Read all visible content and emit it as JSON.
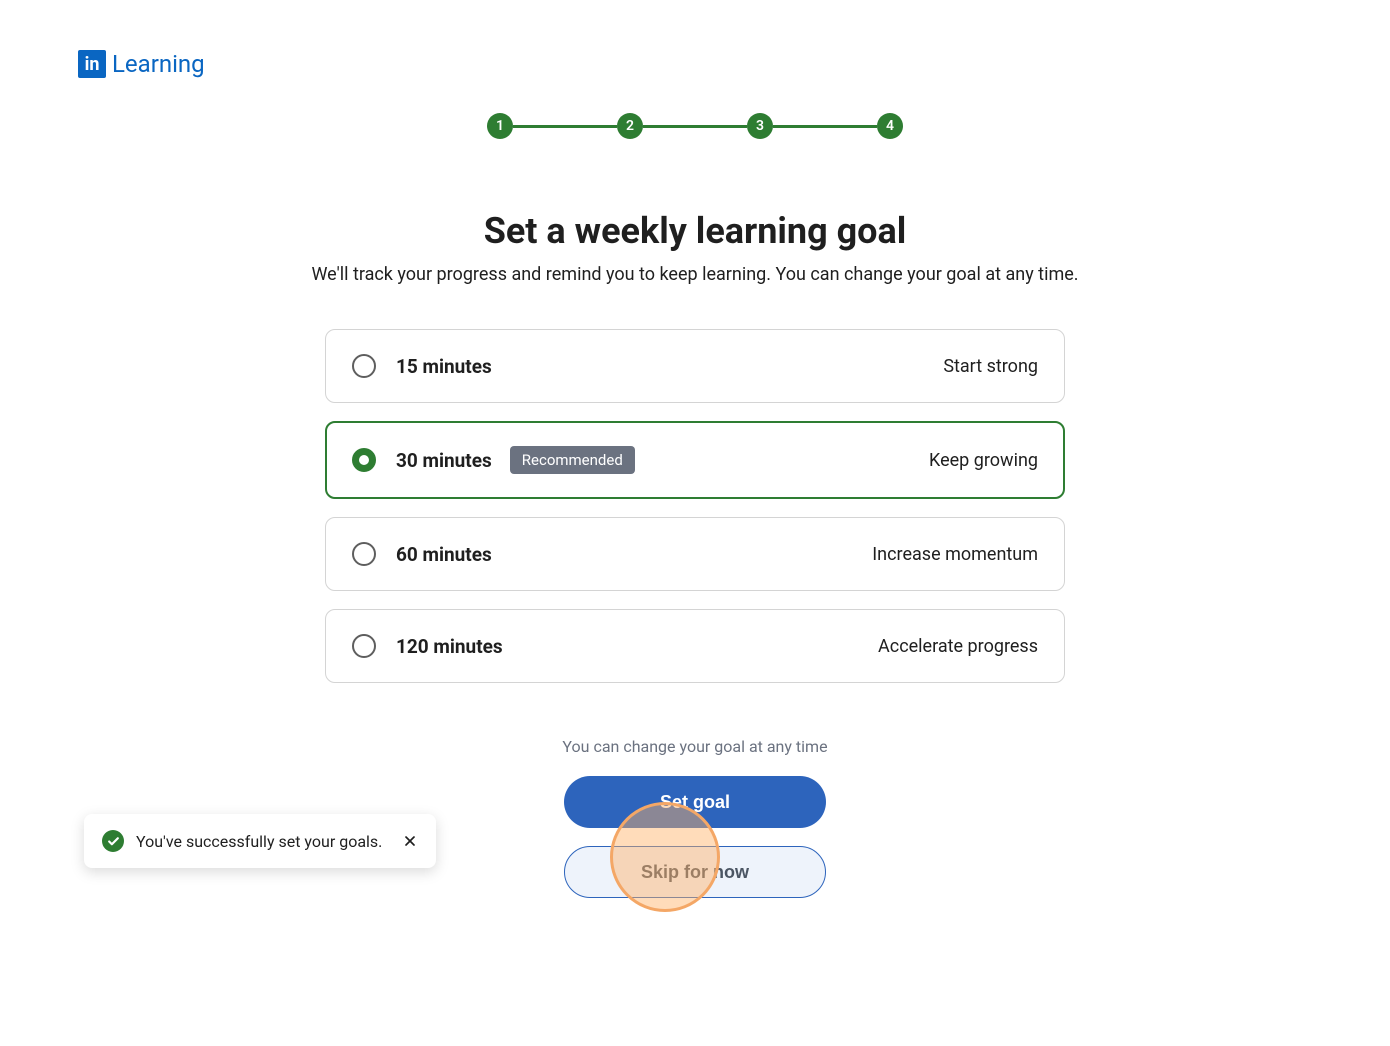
{
  "logo": {
    "mark": "in",
    "text": "Learning"
  },
  "stepper": {
    "steps": [
      "1",
      "2",
      "3",
      "4"
    ]
  },
  "header": {
    "title": "Set a weekly learning goal",
    "subtitle": "We'll track your progress and remind you to keep learning. You can change your goal at any time."
  },
  "options": [
    {
      "label": "15 minutes",
      "desc": "Start strong",
      "selected": false,
      "badge": null
    },
    {
      "label": "30 minutes",
      "desc": "Keep growing",
      "selected": true,
      "badge": "Recommended"
    },
    {
      "label": "60 minutes",
      "desc": "Increase momentum",
      "selected": false,
      "badge": null
    },
    {
      "label": "120 minutes",
      "desc": "Accelerate progress",
      "selected": false,
      "badge": null
    }
  ],
  "footer": {
    "note": "You can change your goal at any time",
    "primary": "Set goal",
    "secondary": "Skip for now"
  },
  "toast": {
    "text": "You've successfully set your goals."
  }
}
